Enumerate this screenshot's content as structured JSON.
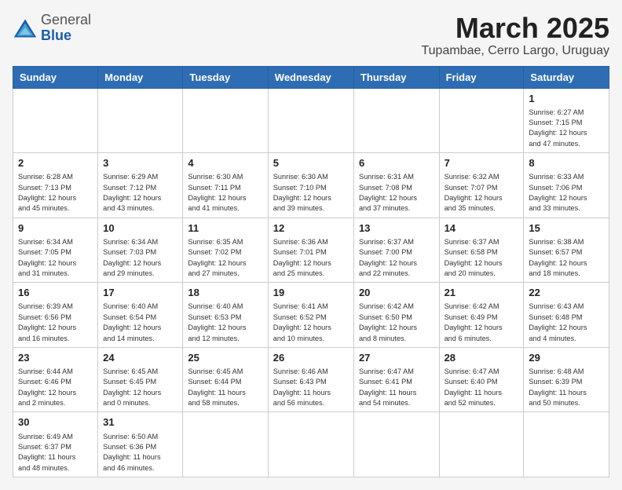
{
  "header": {
    "logo_general": "General",
    "logo_blue": "Blue",
    "month": "March 2025",
    "location": "Tupambae, Cerro Largo, Uruguay"
  },
  "weekdays": [
    "Sunday",
    "Monday",
    "Tuesday",
    "Wednesday",
    "Thursday",
    "Friday",
    "Saturday"
  ],
  "weeks": [
    [
      {
        "day": "",
        "info": ""
      },
      {
        "day": "",
        "info": ""
      },
      {
        "day": "",
        "info": ""
      },
      {
        "day": "",
        "info": ""
      },
      {
        "day": "",
        "info": ""
      },
      {
        "day": "",
        "info": ""
      },
      {
        "day": "1",
        "info": "Sunrise: 6:27 AM\nSunset: 7:15 PM\nDaylight: 12 hours\nand 47 minutes."
      }
    ],
    [
      {
        "day": "2",
        "info": "Sunrise: 6:28 AM\nSunset: 7:13 PM\nDaylight: 12 hours\nand 45 minutes."
      },
      {
        "day": "3",
        "info": "Sunrise: 6:29 AM\nSunset: 7:12 PM\nDaylight: 12 hours\nand 43 minutes."
      },
      {
        "day": "4",
        "info": "Sunrise: 6:30 AM\nSunset: 7:11 PM\nDaylight: 12 hours\nand 41 minutes."
      },
      {
        "day": "5",
        "info": "Sunrise: 6:30 AM\nSunset: 7:10 PM\nDaylight: 12 hours\nand 39 minutes."
      },
      {
        "day": "6",
        "info": "Sunrise: 6:31 AM\nSunset: 7:08 PM\nDaylight: 12 hours\nand 37 minutes."
      },
      {
        "day": "7",
        "info": "Sunrise: 6:32 AM\nSunset: 7:07 PM\nDaylight: 12 hours\nand 35 minutes."
      },
      {
        "day": "8",
        "info": "Sunrise: 6:33 AM\nSunset: 7:06 PM\nDaylight: 12 hours\nand 33 minutes."
      }
    ],
    [
      {
        "day": "9",
        "info": "Sunrise: 6:34 AM\nSunset: 7:05 PM\nDaylight: 12 hours\nand 31 minutes."
      },
      {
        "day": "10",
        "info": "Sunrise: 6:34 AM\nSunset: 7:03 PM\nDaylight: 12 hours\nand 29 minutes."
      },
      {
        "day": "11",
        "info": "Sunrise: 6:35 AM\nSunset: 7:02 PM\nDaylight: 12 hours\nand 27 minutes."
      },
      {
        "day": "12",
        "info": "Sunrise: 6:36 AM\nSunset: 7:01 PM\nDaylight: 12 hours\nand 25 minutes."
      },
      {
        "day": "13",
        "info": "Sunrise: 6:37 AM\nSunset: 7:00 PM\nDaylight: 12 hours\nand 22 minutes."
      },
      {
        "day": "14",
        "info": "Sunrise: 6:37 AM\nSunset: 6:58 PM\nDaylight: 12 hours\nand 20 minutes."
      },
      {
        "day": "15",
        "info": "Sunrise: 6:38 AM\nSunset: 6:57 PM\nDaylight: 12 hours\nand 18 minutes."
      }
    ],
    [
      {
        "day": "16",
        "info": "Sunrise: 6:39 AM\nSunset: 6:56 PM\nDaylight: 12 hours\nand 16 minutes."
      },
      {
        "day": "17",
        "info": "Sunrise: 6:40 AM\nSunset: 6:54 PM\nDaylight: 12 hours\nand 14 minutes."
      },
      {
        "day": "18",
        "info": "Sunrise: 6:40 AM\nSunset: 6:53 PM\nDaylight: 12 hours\nand 12 minutes."
      },
      {
        "day": "19",
        "info": "Sunrise: 6:41 AM\nSunset: 6:52 PM\nDaylight: 12 hours\nand 10 minutes."
      },
      {
        "day": "20",
        "info": "Sunrise: 6:42 AM\nSunset: 6:50 PM\nDaylight: 12 hours\nand 8 minutes."
      },
      {
        "day": "21",
        "info": "Sunrise: 6:42 AM\nSunset: 6:49 PM\nDaylight: 12 hours\nand 6 minutes."
      },
      {
        "day": "22",
        "info": "Sunrise: 6:43 AM\nSunset: 6:48 PM\nDaylight: 12 hours\nand 4 minutes."
      }
    ],
    [
      {
        "day": "23",
        "info": "Sunrise: 6:44 AM\nSunset: 6:46 PM\nDaylight: 12 hours\nand 2 minutes."
      },
      {
        "day": "24",
        "info": "Sunrise: 6:45 AM\nSunset: 6:45 PM\nDaylight: 12 hours\nand 0 minutes."
      },
      {
        "day": "25",
        "info": "Sunrise: 6:45 AM\nSunset: 6:44 PM\nDaylight: 11 hours\nand 58 minutes."
      },
      {
        "day": "26",
        "info": "Sunrise: 6:46 AM\nSunset: 6:43 PM\nDaylight: 11 hours\nand 56 minutes."
      },
      {
        "day": "27",
        "info": "Sunrise: 6:47 AM\nSunset: 6:41 PM\nDaylight: 11 hours\nand 54 minutes."
      },
      {
        "day": "28",
        "info": "Sunrise: 6:47 AM\nSunset: 6:40 PM\nDaylight: 11 hours\nand 52 minutes."
      },
      {
        "day": "29",
        "info": "Sunrise: 6:48 AM\nSunset: 6:39 PM\nDaylight: 11 hours\nand 50 minutes."
      }
    ],
    [
      {
        "day": "30",
        "info": "Sunrise: 6:49 AM\nSunset: 6:37 PM\nDaylight: 11 hours\nand 48 minutes."
      },
      {
        "day": "31",
        "info": "Sunrise: 6:50 AM\nSunset: 6:36 PM\nDaylight: 11 hours\nand 46 minutes."
      },
      {
        "day": "",
        "info": ""
      },
      {
        "day": "",
        "info": ""
      },
      {
        "day": "",
        "info": ""
      },
      {
        "day": "",
        "info": ""
      },
      {
        "day": "",
        "info": ""
      }
    ]
  ]
}
